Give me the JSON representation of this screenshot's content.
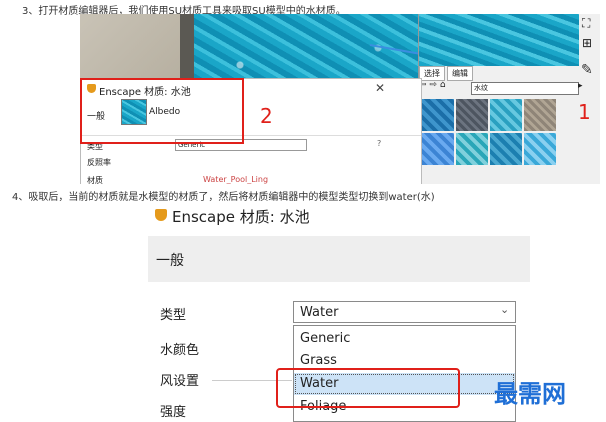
{
  "step3": "3、打开材质编辑器后，我们使用SU材质工具来吸取SU模型中的水材质。",
  "step4": "4、吸取后，当前的材质就是水模型的材质了，然后将材质编辑器中的模型类型切换到water(水)",
  "su_panel": {
    "tab_select": "选择",
    "tab_edit": "编辑",
    "library": "水纹"
  },
  "enscape_small": {
    "title": "Enscape 材质: 水池",
    "tab_general": "一般",
    "albedo": "Albedo",
    "row_type": "类型",
    "type_value": "Generic",
    "row_reflect": "反照率",
    "row_texture": "材质",
    "texture_value": "Water_Pool_Ling"
  },
  "callouts": {
    "n1": "1",
    "n2": "2"
  },
  "enscape_big": {
    "title": "Enscape 材质: 水池",
    "tab_general": "一般",
    "label_type": "类型",
    "label_water_color": "水颜色",
    "label_wind": "风设置",
    "label_strength": "强度",
    "selected_value": "Water",
    "options": [
      "Generic",
      "Grass",
      "Water",
      "Foliage"
    ]
  },
  "watermark": "最需网",
  "colors": {
    "callout_red": "#e0201a",
    "watermark_blue": "#1f6fd6",
    "selected_option": "#cde3f7"
  }
}
